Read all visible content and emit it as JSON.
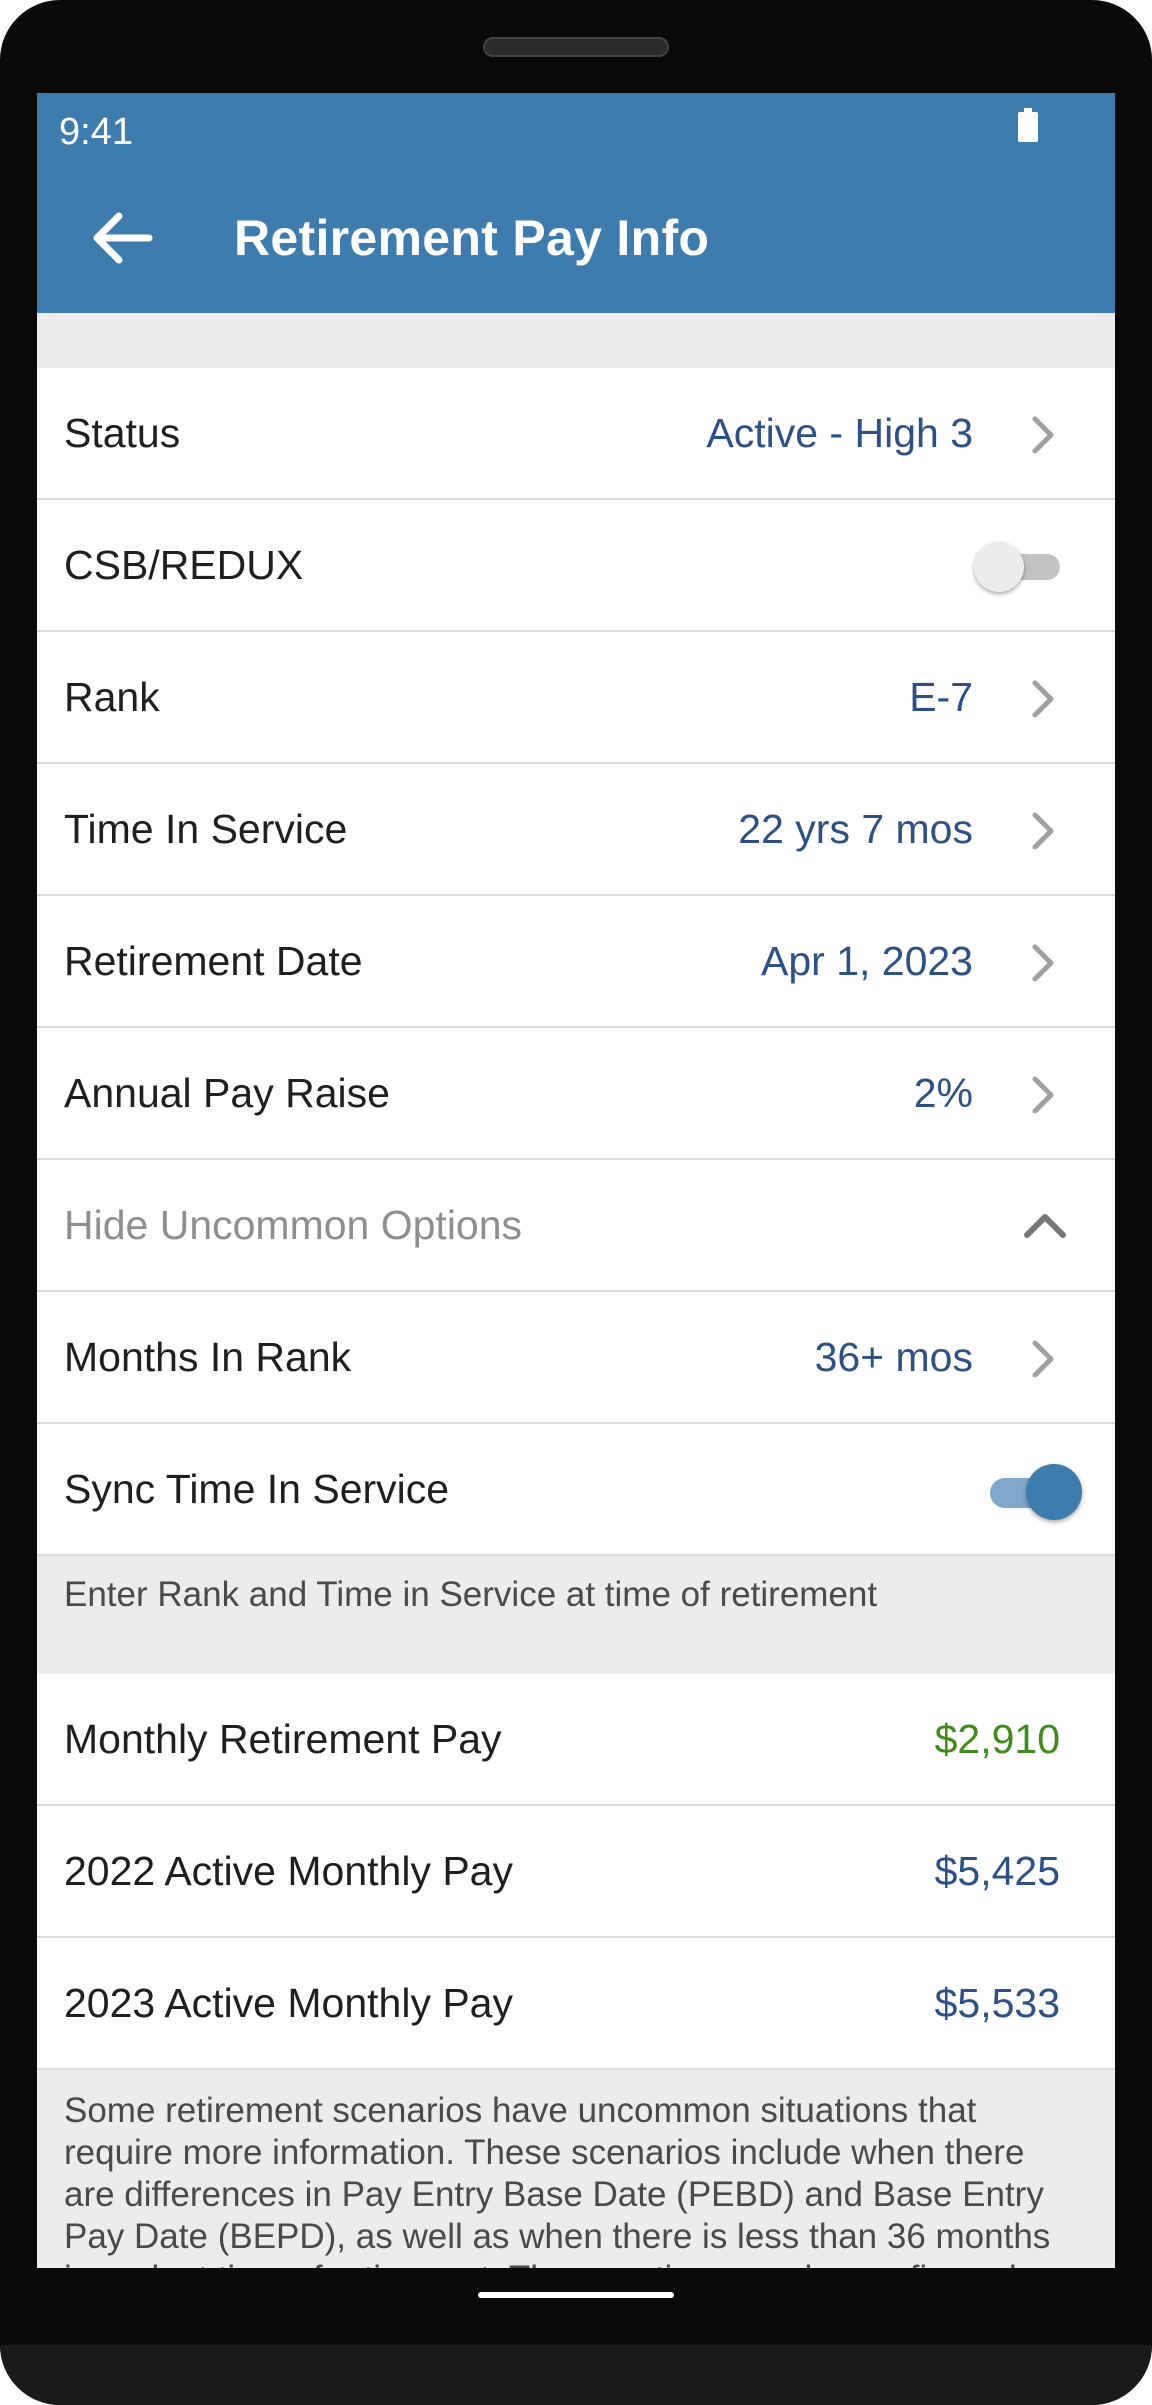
{
  "status_bar": {
    "time": "9:41"
  },
  "app_bar": {
    "title": "Retirement Pay Info"
  },
  "rows": [
    {
      "label": "Status",
      "value": "Active - High 3"
    },
    {
      "label": "CSB/REDUX",
      "toggle": false
    },
    {
      "label": "Rank",
      "value": "E-7"
    },
    {
      "label": "Time In Service",
      "value": "22 yrs 7 mos"
    },
    {
      "label": "Retirement Date",
      "value": "Apr 1, 2023"
    },
    {
      "label": "Annual Pay Raise",
      "value": "2%"
    },
    {
      "label": "Hide Uncommon Options"
    },
    {
      "label": "Months In Rank",
      "value": "36+ mos"
    },
    {
      "label": "Sync Time In Service",
      "toggle": true
    }
  ],
  "note": "Enter Rank and Time in Service at time of retirement",
  "results": [
    {
      "label": "Monthly Retirement Pay",
      "value": "$2,910"
    },
    {
      "label": "2022 Active Monthly Pay",
      "value": "$5,425"
    },
    {
      "label": "2023 Active Monthly Pay",
      "value": "$5,533"
    }
  ],
  "footer_note": "Some retirement scenarios have uncommon situations that require more information. These scenarios include when there are differences in Pay Entry Base Date (PEBD) and Base Entry Pay Date (BEPD), as well as when there is less than 36 months in rank at time of retirement. These options can be configured",
  "colors": {
    "app_bar": "#3e7cad",
    "value_text": "#2d5184",
    "positive_value": "#3f8a1a",
    "background": "#ececec"
  },
  "icons": [
    "back-arrow-icon",
    "chevron-right-icon",
    "chevron-up-icon",
    "battery-icon"
  ]
}
